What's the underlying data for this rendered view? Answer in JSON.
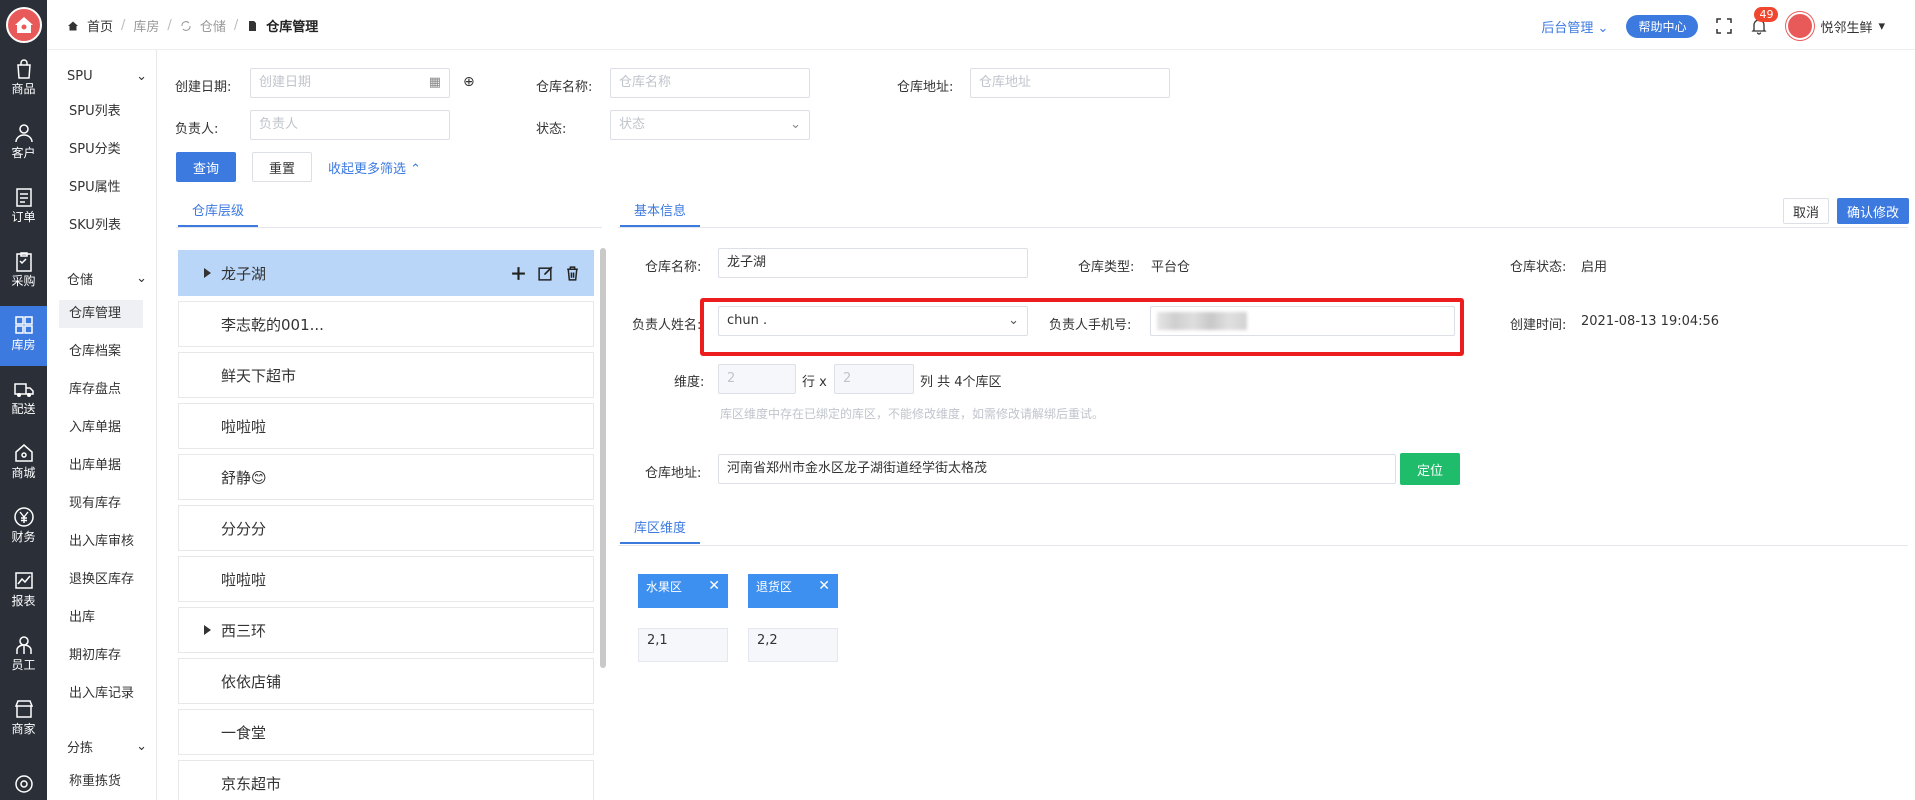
{
  "rail": {
    "items": [
      {
        "label": "商品",
        "icon": "bag-icon"
      },
      {
        "label": "客户",
        "icon": "person-icon"
      },
      {
        "label": "订单",
        "icon": "order-icon"
      },
      {
        "label": "采购",
        "icon": "clipboard-icon"
      },
      {
        "label": "库房",
        "icon": "warehouse-icon",
        "active": true
      },
      {
        "label": "配送",
        "icon": "truck-icon"
      },
      {
        "label": "商城",
        "icon": "house-icon"
      },
      {
        "label": "财务",
        "icon": "yen-icon"
      },
      {
        "label": "报表",
        "icon": "chart-icon"
      },
      {
        "label": "员工",
        "icon": "staff-icon"
      },
      {
        "label": "商家",
        "icon": "shop-icon"
      }
    ]
  },
  "subnav": {
    "groups": [
      {
        "label": "SPU",
        "items": [
          "SPU列表",
          "SPU分类",
          "SPU属性",
          "SKU列表"
        ]
      },
      {
        "label": "仓储",
        "items": [
          "仓库管理",
          "仓库档案",
          "库存盘点",
          "入库单据",
          "出库单据",
          "现有库存",
          "出入库审核",
          "退换区库存",
          "出库",
          "期初库存",
          "出入库记录"
        ]
      },
      {
        "label": "分拣",
        "items": [
          "称重拣货"
        ]
      }
    ],
    "active_item": "仓库管理"
  },
  "header": {
    "crumbs": [
      "首页",
      "库房",
      "仓储",
      "仓库管理"
    ],
    "admin_link": "后台管理",
    "help_button": "帮助中心",
    "notification_count": "49",
    "user_name": "悦邻生鲜"
  },
  "filters": {
    "create_date_label": "创建日期:",
    "create_date_placeholder": "创建日期",
    "name_label": "仓库名称:",
    "name_placeholder": "仓库名称",
    "address_label": "仓库地址:",
    "address_placeholder": "仓库地址",
    "owner_label": "负责人:",
    "owner_placeholder": "负责人",
    "status_label": "状态:",
    "status_placeholder": "状态",
    "query_button": "查询",
    "reset_button": "重置",
    "collapse_link": "收起更多筛选"
  },
  "tabs": {
    "tree_tab": "仓库层级",
    "info_tab": "基本信息",
    "zone_tab": "库区维度"
  },
  "actions": {
    "cancel": "取消",
    "confirm": "确认修改"
  },
  "tree": [
    {
      "name": "龙子湖",
      "expandable": true,
      "selected": true
    },
    {
      "name": "李志乾的001...",
      "expandable": false
    },
    {
      "name": "鲜天下超市",
      "expandable": false
    },
    {
      "name": "啦啦啦",
      "expandable": false
    },
    {
      "name": "舒静😊",
      "expandable": false
    },
    {
      "name": "分分分",
      "expandable": false
    },
    {
      "name": "啦啦啦",
      "expandable": false
    },
    {
      "name": "西三环",
      "expandable": true
    },
    {
      "name": "依依店铺",
      "expandable": false
    },
    {
      "name": "一食堂",
      "expandable": false
    },
    {
      "name": "京东超市",
      "expandable": false
    }
  ],
  "info": {
    "name_label": "仓库名称:",
    "name_value": "龙子湖",
    "type_label": "仓库类型:",
    "type_value": "平台仓",
    "status_label": "仓库状态:",
    "status_value": "启用",
    "owner_label": "负责人姓名:",
    "owner_value": "chun .",
    "phone_label": "负责人手机号:",
    "created_label": "创建时间:",
    "created_value": "2021-08-13 19:04:56",
    "dim_label": "维度:",
    "dim_rows": "2",
    "dim_rows_unit": "行 x",
    "dim_cols": "2",
    "dim_cols_unit": "列 共 4个库区",
    "dim_hint": "库区维度中存在已绑定的库区，不能修改维度，如需修改请解绑后重试。",
    "address_label": "仓库地址:",
    "address_value": "河南省郑州市金水区龙子湖街道经学街太格茂",
    "locate_button": "定位"
  },
  "zones": [
    {
      "name": "水果区",
      "pos": "2,1"
    },
    {
      "name": "退货区",
      "pos": "2,2"
    }
  ]
}
